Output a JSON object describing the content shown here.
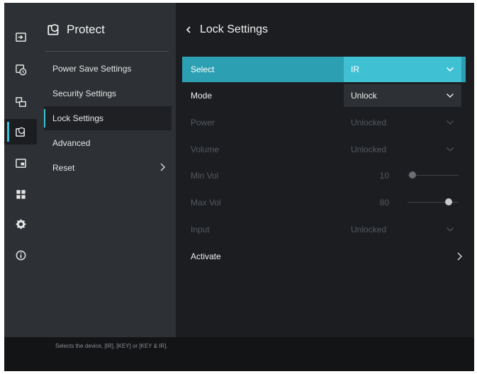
{
  "rail": {
    "items": [
      {
        "icon": "input-icon",
        "active": false
      },
      {
        "icon": "clock-icon",
        "active": false
      },
      {
        "icon": "multi-display-icon",
        "active": false
      },
      {
        "icon": "protect-icon",
        "active": true
      },
      {
        "icon": "picture-in-picture-icon",
        "active": false
      },
      {
        "icon": "grid-icon",
        "active": false
      },
      {
        "icon": "gear-icon",
        "active": false
      },
      {
        "icon": "info-icon",
        "active": false
      }
    ]
  },
  "menu": {
    "title": "Protect",
    "items": [
      {
        "label": "Power Save Settings"
      },
      {
        "label": "Security Settings"
      },
      {
        "label": "Lock Settings",
        "active": true
      },
      {
        "label": "Advanced"
      },
      {
        "label": "Reset",
        "has_submenu": true
      }
    ]
  },
  "panel": {
    "title": "Lock Settings",
    "rows": {
      "select": {
        "label": "Select",
        "value": "IR"
      },
      "mode": {
        "label": "Mode",
        "value": "Unlock"
      },
      "power": {
        "label": "Power",
        "value": "Unlocked"
      },
      "volume": {
        "label": "Volume",
        "value": "Unlocked"
      },
      "min_vol": {
        "label": "Min Vol",
        "value": "10",
        "level": 0.1
      },
      "max_vol": {
        "label": "Max Vol",
        "value": "80",
        "level": 0.8
      },
      "input": {
        "label": "Input",
        "value": "Unlocked"
      },
      "activate": {
        "label": "Activate"
      }
    }
  },
  "status": {
    "text": "Selects the device, [IR], [KEY] or [KEY & IR]."
  },
  "colors": {
    "accent": "#3fc1d3",
    "selected_row": "#2d9fb2",
    "background": "#1b1d20",
    "menu_background": "#2d3034"
  }
}
